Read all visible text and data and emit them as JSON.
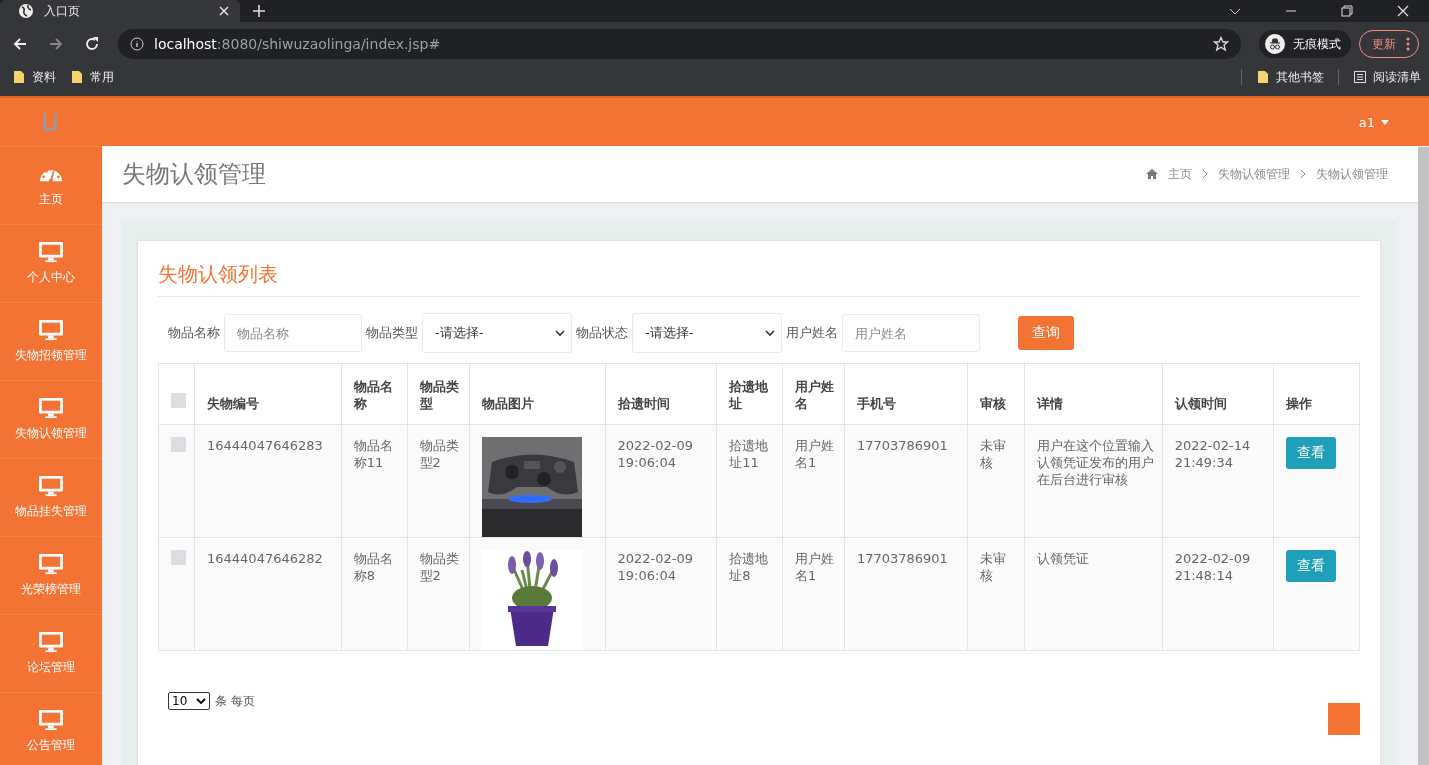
{
  "browser": {
    "tab_title": "入口页",
    "url_host": "localhost",
    "url_rest": ":8080/shiwuzaolinga/index.jsp#",
    "incognito_label": "无痕模式",
    "update_label": "更新",
    "bookmarks": [
      "资料",
      "常用"
    ],
    "other_bookmarks": "其他书签",
    "reading_list": "阅读清单"
  },
  "header": {
    "user": "a1"
  },
  "sidebar": {
    "items": [
      {
        "label": "主页",
        "kind": "dashboard",
        "selected": false
      },
      {
        "label": "个人中心",
        "kind": "monitor",
        "selected": false
      },
      {
        "label": "失物招领管理",
        "kind": "monitor",
        "selected": false
      },
      {
        "label": "失物认领管理",
        "kind": "monitor",
        "selected": false
      },
      {
        "label": "物品挂失管理",
        "kind": "monitor",
        "selected": false
      },
      {
        "label": "光荣榜管理",
        "kind": "monitor",
        "selected": false
      },
      {
        "label": "论坛管理",
        "kind": "monitor",
        "selected": false
      },
      {
        "label": "公告管理",
        "kind": "monitor",
        "selected": false
      }
    ]
  },
  "page_title": "失物认领管理",
  "breadcrumb": [
    "主页",
    "失物认领管理",
    "失物认领管理"
  ],
  "card_title": "失物认领列表",
  "filters": [
    {
      "label": "物品名称",
      "kind": "input",
      "placeholder": "物品名称"
    },
    {
      "label": "物品类型",
      "kind": "select",
      "value": "-请选择-"
    },
    {
      "label": "物品状态",
      "kind": "select",
      "value": "-请选择-"
    },
    {
      "label": "用户姓名",
      "kind": "input",
      "placeholder": "用户姓名"
    }
  ],
  "search_button": "查询",
  "table": {
    "select_all_checked": false,
    "columns": [
      "失物编号",
      "物品名称",
      "物品类型",
      "物品图片",
      "拾遗时间",
      "拾遗地址",
      "用户姓名",
      "手机号",
      "审核",
      "详情",
      "认领时间",
      "操作"
    ],
    "rows": [
      {
        "checked": false,
        "id": "16444047646283",
        "name": "物品名称11",
        "type": "物品类型2",
        "time": "2022-02-09 19:06:04",
        "address": "拾遗地址11",
        "user": "用户姓名1",
        "phone": "17703786901",
        "review": "未审核",
        "detail": "用户在这个位置输入认领凭证发布的用户在后台进行审核",
        "claim_time": "2022-02-14 21:49:34",
        "action": "查看"
      },
      {
        "checked": false,
        "id": "16444047646282",
        "name": "物品名称8",
        "type": "物品类型2",
        "time": "2022-02-09 19:06:04",
        "address": "拾遗地址8",
        "user": "用户姓名1",
        "phone": "17703786901",
        "review": "未审核",
        "detail": "认领凭证",
        "claim_time": "2022-02-09 21:48:14",
        "action": "查看"
      }
    ]
  },
  "page_size": "10",
  "page_size_suffix": "条 每页"
}
